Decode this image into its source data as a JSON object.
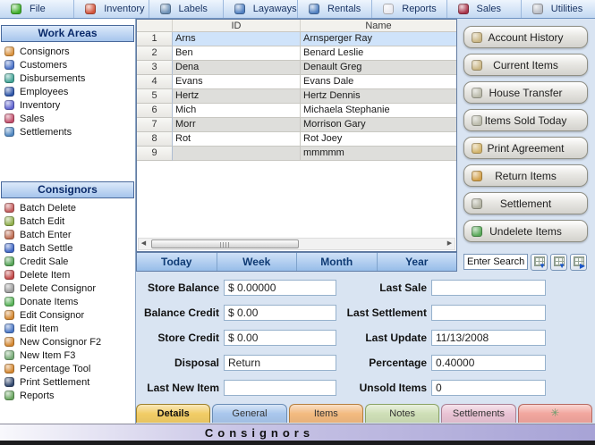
{
  "menubar": {
    "items": [
      {
        "label": "File",
        "icon": "file-icon",
        "icon_color": "#3fae2a"
      },
      {
        "label": "Inventory",
        "icon": "inventory-icon",
        "icon_color": "#d2543c"
      },
      {
        "label": "Labels",
        "icon": "labels-icon",
        "icon_color": "#6b8fb5"
      },
      {
        "label": "Layaways",
        "icon": "layaways-icon",
        "icon_color": "#4f7fc0"
      },
      {
        "label": "Rentals",
        "icon": "rentals-icon",
        "icon_color": "#4f7fc0"
      },
      {
        "label": "Reports",
        "icon": "reports-icon",
        "icon_color": "#e9e9ef"
      },
      {
        "label": "Sales",
        "icon": "sales-icon",
        "icon_color": "#a8334a"
      },
      {
        "label": "Utilities",
        "icon": "utilities-icon",
        "icon_color": "#b9bcc4"
      }
    ]
  },
  "sidebar": {
    "work_areas": {
      "title": "Work Areas",
      "items": [
        {
          "label": "Consignors",
          "icon": "consignors-icon",
          "icon_color": "#d9923f"
        },
        {
          "label": "Customers",
          "icon": "customers-icon",
          "icon_color": "#4a72c8"
        },
        {
          "label": "Disbursements",
          "icon": "disbursements-icon",
          "icon_color": "#42a396"
        },
        {
          "label": "Employees",
          "icon": "employees-icon",
          "icon_color": "#2e55a8"
        },
        {
          "label": "Inventory",
          "icon": "inventory-box-icon",
          "icon_color": "#5f63cf"
        },
        {
          "label": "Sales",
          "icon": "sales-tag-icon",
          "icon_color": "#c24e6b"
        },
        {
          "label": "Settlements",
          "icon": "settlements-icon",
          "icon_color": "#4f86bf"
        }
      ]
    },
    "consignors": {
      "title": "Consignors",
      "items": [
        {
          "label": "Batch Delete",
          "icon": "batch-delete-icon",
          "icon_color": "#c25a5a"
        },
        {
          "label": "Batch Edit",
          "icon": "batch-edit-icon",
          "icon_color": "#8fae4c"
        },
        {
          "label": "Batch Enter",
          "icon": "batch-enter-icon",
          "icon_color": "#bd6b51"
        },
        {
          "label": "Batch Settle",
          "icon": "batch-settle-icon",
          "icon_color": "#3f66c4"
        },
        {
          "label": "Credit Sale",
          "icon": "credit-sale-icon",
          "icon_color": "#55a356"
        },
        {
          "label": "Delete Item",
          "icon": "delete-item-icon",
          "icon_color": "#c24747"
        },
        {
          "label": "Delete Consignor",
          "icon": "delete-consignor-icon",
          "icon_color": "#9a9a9a"
        },
        {
          "label": "Donate Items",
          "icon": "donate-items-icon",
          "icon_color": "#57b157"
        },
        {
          "label": "Edit Consignor",
          "icon": "edit-consignor-icon",
          "icon_color": "#d3862f"
        },
        {
          "label": "Edit Item",
          "icon": "edit-item-icon",
          "icon_color": "#4a76c4"
        },
        {
          "label": "New Consignor  F2",
          "icon": "new-consignor-icon",
          "icon_color": "#d3862f"
        },
        {
          "label": "New Item  F3",
          "icon": "new-item-icon",
          "icon_color": "#74a874"
        },
        {
          "label": "Percentage Tool",
          "icon": "percentage-tool-icon",
          "icon_color": "#d3862f"
        },
        {
          "label": "Print Settlement",
          "icon": "print-settlement-icon",
          "icon_color": "#32486e"
        },
        {
          "label": "Reports",
          "icon": "reports-doc-icon",
          "icon_color": "#67a35d"
        }
      ]
    }
  },
  "table": {
    "columns": [
      "ID",
      "Name"
    ],
    "rows": [
      {
        "num": "1",
        "id": "Arns",
        "name": "Arnsperger Ray",
        "state": "selected"
      },
      {
        "num": "2",
        "id": "Ben",
        "name": "Benard Leslie",
        "state": ""
      },
      {
        "num": "3",
        "id": "Dena",
        "name": "Denault Greg",
        "state": ""
      },
      {
        "num": "4",
        "id": "Evans",
        "name": "Evans Dale",
        "state": ""
      },
      {
        "num": "5",
        "id": "Hertz",
        "name": "Hertz Dennis",
        "state": ""
      },
      {
        "num": "6",
        "id": "Mich",
        "name": "Michaela Stephanie",
        "state": ""
      },
      {
        "num": "7",
        "id": "Morr",
        "name": "Morrison Gary",
        "state": ""
      },
      {
        "num": "8",
        "id": "Rot",
        "name": "Rot Joey",
        "state": ""
      },
      {
        "num": "9",
        "id": "",
        "name": "mmmmm",
        "state": ""
      }
    ],
    "scrollbar": {
      "left_arrow": "◀",
      "right_arrow": "▶"
    }
  },
  "actions": {
    "buttons": [
      {
        "label": "Account History",
        "icon": "account-history-icon",
        "icon_color": "#c9b583"
      },
      {
        "label": "Current Items",
        "icon": "current-items-icon",
        "icon_color": "#c9b583"
      },
      {
        "label": "House Transfer",
        "icon": "house-transfer-icon",
        "icon_color": "#b9b9a9"
      },
      {
        "label": "Items Sold Today",
        "icon": "items-sold-today-icon",
        "icon_color": "#b9b9a9"
      },
      {
        "label": "Print Agreement",
        "icon": "print-agreement-icon",
        "icon_color": "#d2b36a"
      },
      {
        "label": "Return Items",
        "icon": "return-items-icon",
        "icon_color": "#d2a04a"
      },
      {
        "label": "Settlement",
        "icon": "settlement-icon",
        "icon_color": "#b0b0a0"
      },
      {
        "label": "Undelete Items",
        "icon": "undelete-items-icon",
        "icon_color": "#58a858"
      }
    ]
  },
  "period_tabs": {
    "items": [
      {
        "label": "Today"
      },
      {
        "label": "Week"
      },
      {
        "label": "Month"
      },
      {
        "label": "Year"
      }
    ]
  },
  "search": {
    "value": "Enter Search",
    "buttons": [
      {
        "arrow": "▼"
      },
      {
        "arrow": "▼"
      },
      {
        "arrow": "▶"
      }
    ]
  },
  "form": {
    "left": [
      {
        "label": "Store Balance",
        "value": "$ 0.00000"
      },
      {
        "label": "Balance Credit",
        "value": "$ 0.00"
      },
      {
        "label": "Store Credit",
        "value": "$ 0.00"
      },
      {
        "label": "Disposal",
        "value": "Return"
      },
      {
        "label": "Last New Item",
        "value": ""
      }
    ],
    "right": [
      {
        "label": "Last Sale",
        "value": ""
      },
      {
        "label": "Last Settlement",
        "value": ""
      },
      {
        "label": "Last Update",
        "value": "11/13/2008"
      },
      {
        "label": "Percentage",
        "value": "0.40000"
      },
      {
        "label": "Unsold Items",
        "value": "0"
      }
    ]
  },
  "bottom_tabs": {
    "items": [
      {
        "label": "Details",
        "glyph": "",
        "state": "active",
        "bg": "#f2cd66",
        "border": "#9d802c"
      },
      {
        "label": "General",
        "glyph": "",
        "state": "",
        "bg": "#a9c7ed",
        "border": "#6a8db6"
      },
      {
        "label": "Items",
        "glyph": "",
        "state": "",
        "bg": "#f3ba80",
        "border": "#b57f3f"
      },
      {
        "label": "Notes",
        "glyph": "",
        "state": "",
        "bg": "#cfdfb7",
        "border": "#8aa264"
      },
      {
        "label": "Settlements",
        "glyph": "",
        "state": "",
        "bg": "#e9c3d4",
        "border": "#a97f93"
      },
      {
        "label": "",
        "glyph": "✳",
        "state": "",
        "bg": "#f2a69e",
        "border": "#b56a62"
      }
    ]
  },
  "status_bar": {
    "text": "Consignors"
  }
}
